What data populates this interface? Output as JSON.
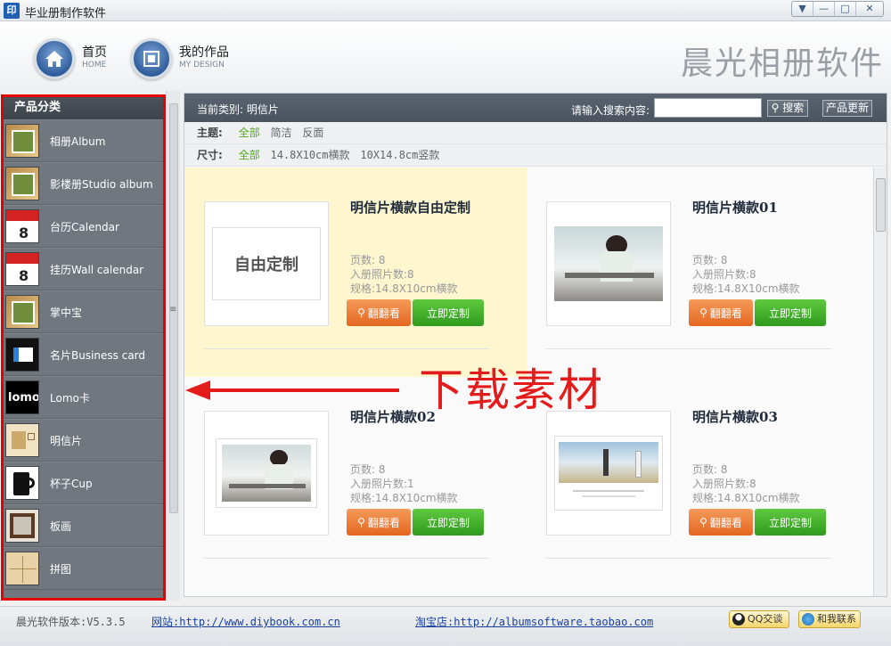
{
  "window": {
    "icon_text": "印",
    "title": "毕业册制作软件",
    "controls": [
      "▼",
      "—",
      "□",
      "✕"
    ]
  },
  "header": {
    "nav": [
      {
        "label": "首页",
        "sub": "HOME",
        "icon": "home-icon"
      },
      {
        "label": "我的作品",
        "sub": "MY DESIGN",
        "icon": "design-icon"
      }
    ],
    "brand": "晨光相册软件"
  },
  "sidebar": {
    "title": "产品分类",
    "items": [
      {
        "label": "相册Album",
        "icon": "album-thumb"
      },
      {
        "label": "影楼册Studio album",
        "icon": "album-thumb"
      },
      {
        "label": "台历Calendar",
        "icon": "calendar-thumb"
      },
      {
        "label": "挂历Wall calendar",
        "icon": "calendar-thumb"
      },
      {
        "label": "掌中宝",
        "icon": "album-thumb"
      },
      {
        "label": "名片Business card",
        "icon": "card-thumb"
      },
      {
        "label": "Lomo卡",
        "icon": "lomo-thumb",
        "thumb_text": "lomo"
      },
      {
        "label": "明信片",
        "icon": "postcard-thumb"
      },
      {
        "label": "杯子Cup",
        "icon": "cup-thumb"
      },
      {
        "label": "板画",
        "icon": "frame-thumb"
      },
      {
        "label": "拼图",
        "icon": "puzzle-thumb"
      }
    ]
  },
  "toolbar": {
    "current_category": "当前类别: 明信片",
    "search_label": "请输入搜索内容:",
    "search_value": "",
    "search_button": "搜索",
    "update_button": "产品更新"
  },
  "filters": {
    "theme": {
      "title": "主题:",
      "options": [
        "全部",
        "简洁",
        "反面"
      ],
      "active": 0
    },
    "size": {
      "title": "尺寸:",
      "options": [
        "全部",
        "14.8X10cm横款",
        "10X14.8cm竖款"
      ],
      "active": 0
    }
  },
  "products": [
    {
      "title": "明信片横款自由定制",
      "thumb_text": "自由定制",
      "pages": "页数: 8",
      "photos": "入册照片数:8",
      "spec": "规格:14.8X10cm横款",
      "view": "翻翻看",
      "order": "立即定制",
      "highlight": true
    },
    {
      "title": "明信片横款01",
      "pages": "页数: 8",
      "photos": "入册照片数:8",
      "spec": "规格:14.8X10cm横款",
      "view": "翻翻看",
      "order": "立即定制",
      "highlight": false
    },
    {
      "title": "明信片横款02",
      "pages": "页数: 8",
      "photos": "入册照片数:1",
      "spec": "规格:14.8X10cm横款",
      "view": "翻翻看",
      "order": "立即定制",
      "highlight": false
    },
    {
      "title": "明信片横款03",
      "pages": "页数: 8",
      "photos": "入册照片数:8",
      "spec": "规格:14.8X10cm横款",
      "view": "翻翻看",
      "order": "立即定制",
      "highlight": false
    }
  ],
  "annotation": {
    "text": "下载素材",
    "color": "#e41b1b"
  },
  "statusbar": {
    "version": "晨光软件版本:V5.3.5",
    "site": "网站:http://www.diybook.com.cn",
    "shop": "淘宝店:http://albumsoftware.taobao.com",
    "qq": "QQ交谈",
    "contact": "和我联系"
  },
  "colors": {
    "sidebar_bg": "#70777f",
    "accent_green": "#52a81c",
    "btn_orange": "#e4661f",
    "btn_green": "#2f9a1d",
    "highlight_bg": "#fdf6cf",
    "sidebar_outline": "#e60000"
  }
}
